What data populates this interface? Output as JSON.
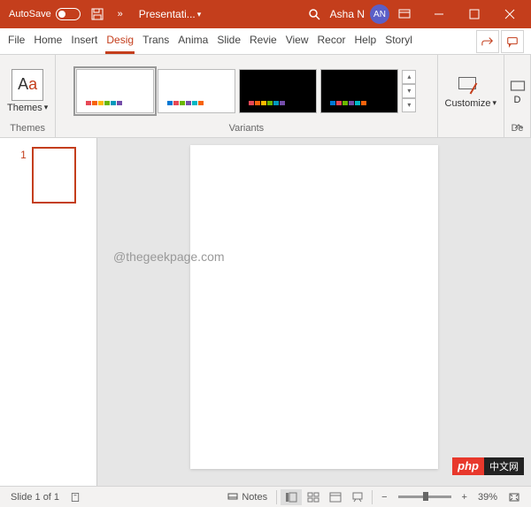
{
  "titlebar": {
    "autosave_label": "AutoSave",
    "autosave_state": "Off",
    "doc_title": "Presentati...",
    "user_name": "Asha N",
    "user_initials": "AN"
  },
  "tabs": {
    "items": [
      "File",
      "Home",
      "Insert",
      "Design",
      "Transitions",
      "Animations",
      "Slide Show",
      "Review",
      "View",
      "Recording",
      "Help",
      "Storyboarding"
    ],
    "display": [
      "File",
      "Home",
      "Insert",
      "Desig",
      "Trans",
      "Anima",
      "Slide",
      "Revie",
      "View",
      "Recor",
      "Help",
      "Storyl"
    ],
    "active_index": 3
  },
  "ribbon": {
    "themes_group_label": "Themes",
    "themes_button_label": "Themes",
    "variants_group_label": "Variants",
    "customize_label": "Customize",
    "designer_label": "De"
  },
  "thumbnails": {
    "slides": [
      {
        "number": "1"
      }
    ]
  },
  "watermark": "@thegeekpage.com",
  "statusbar": {
    "slide_info": "Slide 1 of 1",
    "notes_label": "Notes",
    "zoom_value": "39%"
  },
  "php_badge": {
    "left": "php",
    "right": "中文网"
  }
}
